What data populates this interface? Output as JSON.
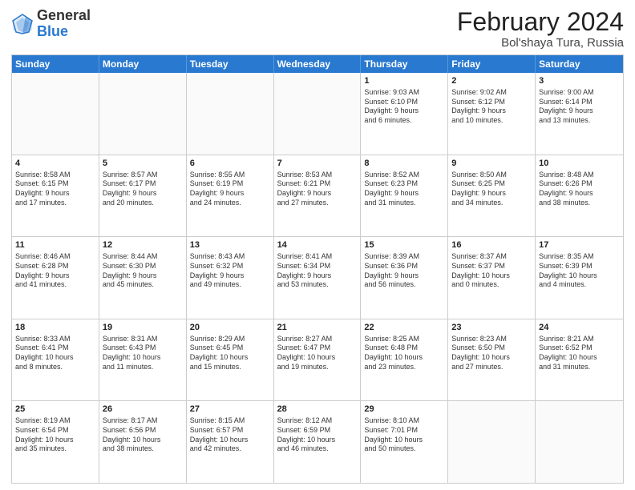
{
  "header": {
    "logo_general": "General",
    "logo_blue": "Blue",
    "month_title": "February 2024",
    "location": "Bol'shaya Tura, Russia"
  },
  "weekdays": [
    "Sunday",
    "Monday",
    "Tuesday",
    "Wednesday",
    "Thursday",
    "Friday",
    "Saturday"
  ],
  "rows": [
    [
      {
        "day": "",
        "info": ""
      },
      {
        "day": "",
        "info": ""
      },
      {
        "day": "",
        "info": ""
      },
      {
        "day": "",
        "info": ""
      },
      {
        "day": "1",
        "info": "Sunrise: 9:03 AM\nSunset: 6:10 PM\nDaylight: 9 hours\nand 6 minutes."
      },
      {
        "day": "2",
        "info": "Sunrise: 9:02 AM\nSunset: 6:12 PM\nDaylight: 9 hours\nand 10 minutes."
      },
      {
        "day": "3",
        "info": "Sunrise: 9:00 AM\nSunset: 6:14 PM\nDaylight: 9 hours\nand 13 minutes."
      }
    ],
    [
      {
        "day": "4",
        "info": "Sunrise: 8:58 AM\nSunset: 6:15 PM\nDaylight: 9 hours\nand 17 minutes."
      },
      {
        "day": "5",
        "info": "Sunrise: 8:57 AM\nSunset: 6:17 PM\nDaylight: 9 hours\nand 20 minutes."
      },
      {
        "day": "6",
        "info": "Sunrise: 8:55 AM\nSunset: 6:19 PM\nDaylight: 9 hours\nand 24 minutes."
      },
      {
        "day": "7",
        "info": "Sunrise: 8:53 AM\nSunset: 6:21 PM\nDaylight: 9 hours\nand 27 minutes."
      },
      {
        "day": "8",
        "info": "Sunrise: 8:52 AM\nSunset: 6:23 PM\nDaylight: 9 hours\nand 31 minutes."
      },
      {
        "day": "9",
        "info": "Sunrise: 8:50 AM\nSunset: 6:25 PM\nDaylight: 9 hours\nand 34 minutes."
      },
      {
        "day": "10",
        "info": "Sunrise: 8:48 AM\nSunset: 6:26 PM\nDaylight: 9 hours\nand 38 minutes."
      }
    ],
    [
      {
        "day": "11",
        "info": "Sunrise: 8:46 AM\nSunset: 6:28 PM\nDaylight: 9 hours\nand 41 minutes."
      },
      {
        "day": "12",
        "info": "Sunrise: 8:44 AM\nSunset: 6:30 PM\nDaylight: 9 hours\nand 45 minutes."
      },
      {
        "day": "13",
        "info": "Sunrise: 8:43 AM\nSunset: 6:32 PM\nDaylight: 9 hours\nand 49 minutes."
      },
      {
        "day": "14",
        "info": "Sunrise: 8:41 AM\nSunset: 6:34 PM\nDaylight: 9 hours\nand 53 minutes."
      },
      {
        "day": "15",
        "info": "Sunrise: 8:39 AM\nSunset: 6:36 PM\nDaylight: 9 hours\nand 56 minutes."
      },
      {
        "day": "16",
        "info": "Sunrise: 8:37 AM\nSunset: 6:37 PM\nDaylight: 10 hours\nand 0 minutes."
      },
      {
        "day": "17",
        "info": "Sunrise: 8:35 AM\nSunset: 6:39 PM\nDaylight: 10 hours\nand 4 minutes."
      }
    ],
    [
      {
        "day": "18",
        "info": "Sunrise: 8:33 AM\nSunset: 6:41 PM\nDaylight: 10 hours\nand 8 minutes."
      },
      {
        "day": "19",
        "info": "Sunrise: 8:31 AM\nSunset: 6:43 PM\nDaylight: 10 hours\nand 11 minutes."
      },
      {
        "day": "20",
        "info": "Sunrise: 8:29 AM\nSunset: 6:45 PM\nDaylight: 10 hours\nand 15 minutes."
      },
      {
        "day": "21",
        "info": "Sunrise: 8:27 AM\nSunset: 6:47 PM\nDaylight: 10 hours\nand 19 minutes."
      },
      {
        "day": "22",
        "info": "Sunrise: 8:25 AM\nSunset: 6:48 PM\nDaylight: 10 hours\nand 23 minutes."
      },
      {
        "day": "23",
        "info": "Sunrise: 8:23 AM\nSunset: 6:50 PM\nDaylight: 10 hours\nand 27 minutes."
      },
      {
        "day": "24",
        "info": "Sunrise: 8:21 AM\nSunset: 6:52 PM\nDaylight: 10 hours\nand 31 minutes."
      }
    ],
    [
      {
        "day": "25",
        "info": "Sunrise: 8:19 AM\nSunset: 6:54 PM\nDaylight: 10 hours\nand 35 minutes."
      },
      {
        "day": "26",
        "info": "Sunrise: 8:17 AM\nSunset: 6:56 PM\nDaylight: 10 hours\nand 38 minutes."
      },
      {
        "day": "27",
        "info": "Sunrise: 8:15 AM\nSunset: 6:57 PM\nDaylight: 10 hours\nand 42 minutes."
      },
      {
        "day": "28",
        "info": "Sunrise: 8:12 AM\nSunset: 6:59 PM\nDaylight: 10 hours\nand 46 minutes."
      },
      {
        "day": "29",
        "info": "Sunrise: 8:10 AM\nSunset: 7:01 PM\nDaylight: 10 hours\nand 50 minutes."
      },
      {
        "day": "",
        "info": ""
      },
      {
        "day": "",
        "info": ""
      }
    ]
  ]
}
